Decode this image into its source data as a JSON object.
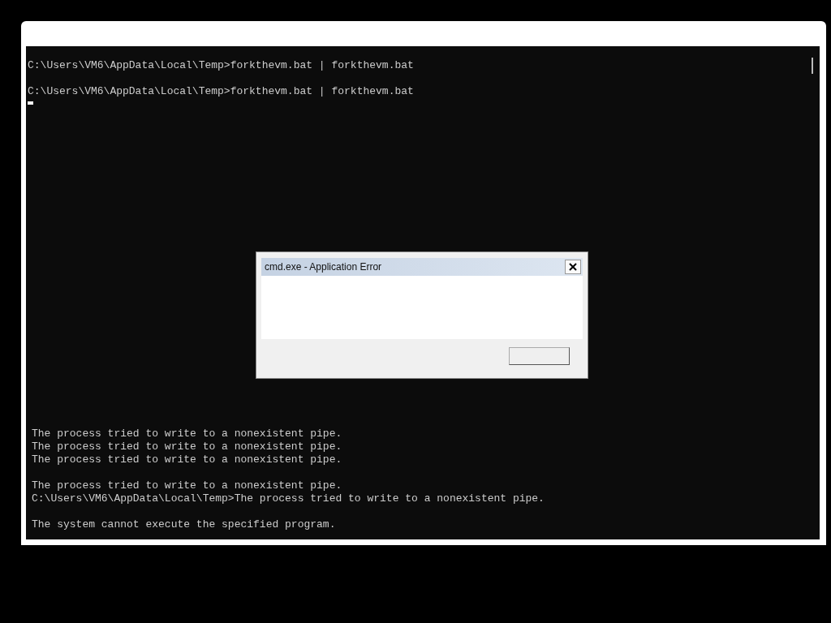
{
  "console": {
    "top_blocks": [
      [
        "C:\\Users\\VM6\\AppData\\Local\\Temp>forkthevm.bat | forkthevm.bat"
      ],
      [
        "C:\\Users\\VM6\\AppData\\Local\\Temp>forkthevm.bat | forkthevm.bat"
      ]
    ],
    "bottom_blocks": [
      [
        "The process tried to write to a nonexistent pipe.",
        "The process tried to write to a nonexistent pipe.",
        "The process tried to write to a nonexistent pipe."
      ],
      [
        "The process tried to write to a nonexistent pipe.",
        "C:\\Users\\VM6\\AppData\\Local\\Temp>The process tried to write to a nonexistent pipe."
      ],
      [
        "The system cannot execute the specified program."
      ]
    ]
  },
  "dialog": {
    "title": "cmd.exe - Application Error"
  }
}
